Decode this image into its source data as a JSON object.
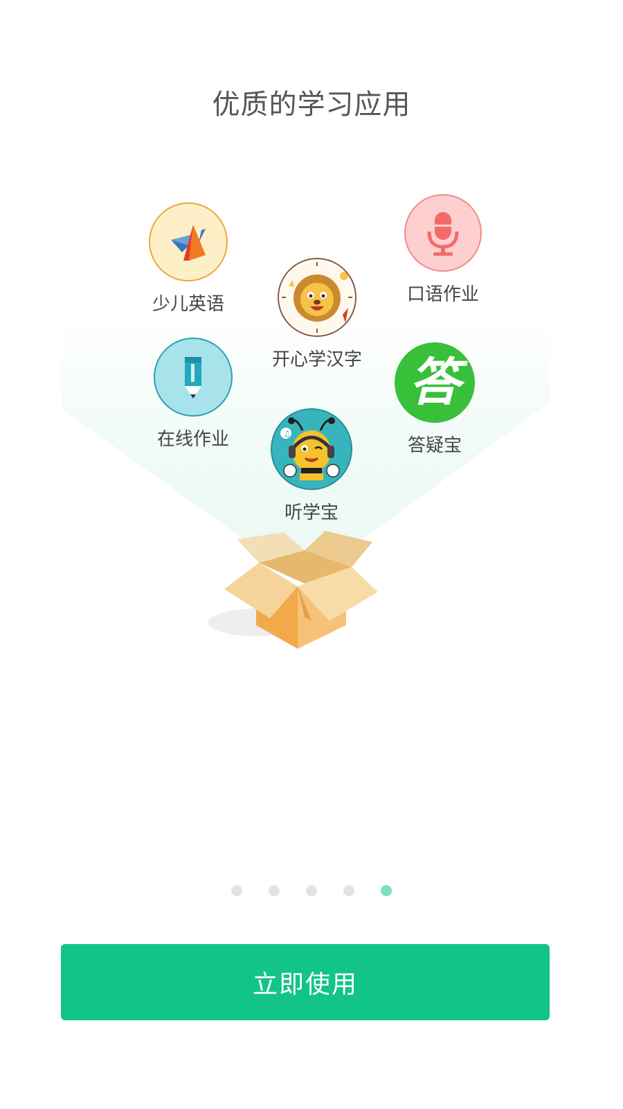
{
  "title": "优质的学习应用",
  "apps": [
    {
      "label": "少儿英语",
      "icon": "shao-er-ying-yu-logo-icon"
    },
    {
      "label": "开心学汉字",
      "icon": "lion-clock-icon"
    },
    {
      "label": "口语作业",
      "icon": "microphone-icon"
    },
    {
      "label": "在线作业",
      "icon": "pencil-icon"
    },
    {
      "label": "答疑宝",
      "icon": "da-yi-bao-icon",
      "glyph": "答"
    },
    {
      "label": "听学宝",
      "icon": "bee-headphones-icon"
    }
  ],
  "pagination": {
    "total": 5,
    "active_index": 4
  },
  "cta": {
    "label": "立即使用"
  },
  "colors": {
    "primary": "#12c487",
    "dot_active": "#7ddfc1",
    "dot_inactive": "#e3e3e3"
  }
}
